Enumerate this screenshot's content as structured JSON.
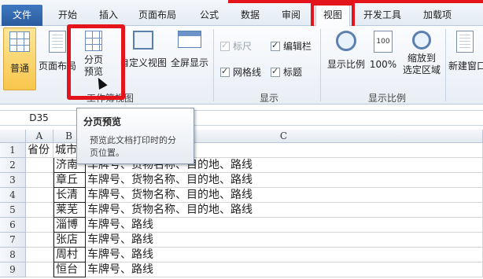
{
  "tabs": {
    "file": "文件",
    "items": [
      "开始",
      "插入",
      "页面布局",
      "公式",
      "数据",
      "审阅",
      "视图",
      "开发工具",
      "加载项"
    ],
    "active": "视图"
  },
  "ribbon": {
    "workbook_views": {
      "normal": "普通",
      "page_layout": "页面布局",
      "page_break_preview_line1": "分页",
      "page_break_preview_line2": "预览",
      "custom_views": "自定义视图",
      "full_screen": "全屏显示",
      "group_label": "工作簿视图"
    },
    "show": {
      "ruler": "标尺",
      "formula_bar": "编辑栏",
      "gridlines": "网格线",
      "headings": "标题",
      "group_label": "显示"
    },
    "zoom": {
      "zoom": "显示比例",
      "hundred": "100%",
      "hundred_icon": "100",
      "zoom_to_selection_line1": "缩放到",
      "zoom_to_selection_line2": "选定区域",
      "group_label": "显示比例"
    },
    "window": {
      "new_window": "新建窗口"
    }
  },
  "formula_bar": {
    "name_box": "D35",
    "formula": ""
  },
  "tooltip": {
    "title": "分页预览",
    "body_line1": "预览此文档打印时的分",
    "body_line2": "页位置。"
  },
  "grid": {
    "columns": [
      "A",
      "B",
      "C"
    ],
    "rows": [
      {
        "num": "1",
        "a": "省份",
        "b": "城市",
        "c": ""
      },
      {
        "num": "2",
        "a": "",
        "b": "济南",
        "c": "车牌号、货物名称、目的地、路线"
      },
      {
        "num": "3",
        "a": "",
        "b": "章丘",
        "c": "车牌号、货物名称、目的地、路线"
      },
      {
        "num": "4",
        "a": "",
        "b": "长清",
        "c": "车牌号、货物名称、目的地、路线"
      },
      {
        "num": "5",
        "a": "",
        "b": "莱芜",
        "c": "车牌号、货物名称、目的地、路线"
      },
      {
        "num": "6",
        "a": "",
        "b": "淄博",
        "c": "车牌号、路线"
      },
      {
        "num": "7",
        "a": "",
        "b": "张店",
        "c": "车牌号、路线"
      },
      {
        "num": "8",
        "a": "",
        "b": "周村",
        "c": "车牌号、路线"
      },
      {
        "num": "9",
        "a": "",
        "b": "恒台",
        "c": "车牌号、路线"
      }
    ]
  },
  "colors": {
    "highlight_red": "#e3141c",
    "file_tab": "#2a5c9f",
    "active_button": "#f8c64b"
  }
}
